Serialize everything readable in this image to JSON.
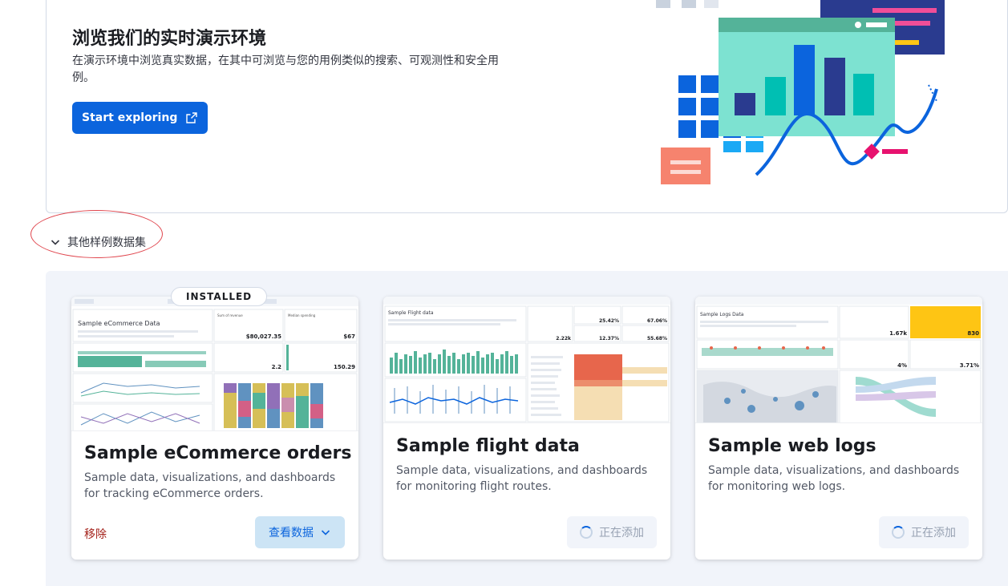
{
  "hero": {
    "title": "浏览我们的实时演示环境",
    "description": "在演示环境中浏览真实数据，在其中可浏览与您的用例类似的搜索、可观测性和安全用例。",
    "start_button": "Start exploring"
  },
  "other_datasets_toggle": "其他样例数据集",
  "cards": [
    {
      "badge": "INSTALLED",
      "title": "Sample eCommerce orders",
      "description": "Sample data, visualizations, and dashboards for tracking eCommerce orders.",
      "remove_label": "移除",
      "view_label": "查看数据",
      "thumb": {
        "heading": "Sample eCommerce Data",
        "sum_label": "Sum of revenue",
        "sum_value": "$80,027.35",
        "median_label": "Median spending",
        "median_value": "$67",
        "avg_value": "2.2",
        "trans_value": "150.29"
      }
    },
    {
      "title": "Sample flight data",
      "description": "Sample data, visualizations, and dashboards for monitoring flight routes.",
      "adding_label": "正在添加",
      "thumb": {
        "heading": "Sample Flight data",
        "v1": "2.22k",
        "v2": "25.42%",
        "v3": "67.06%",
        "v4": "12.37%",
        "v5": "55.68%"
      }
    },
    {
      "title": "Sample web logs",
      "description": "Sample data, visualizations, and dashboards for monitoring web logs.",
      "adding_label": "正在添加",
      "thumb": {
        "heading": "Sample Logs Data",
        "v1": "1.67k",
        "v2": "830",
        "v3": "4%",
        "v4": "3.71%"
      }
    }
  ],
  "colors": {
    "primary": "#0b64dd",
    "danger": "#a4211a",
    "panel_bg": "#f1f4fa",
    "annotation": "#e0464e"
  }
}
